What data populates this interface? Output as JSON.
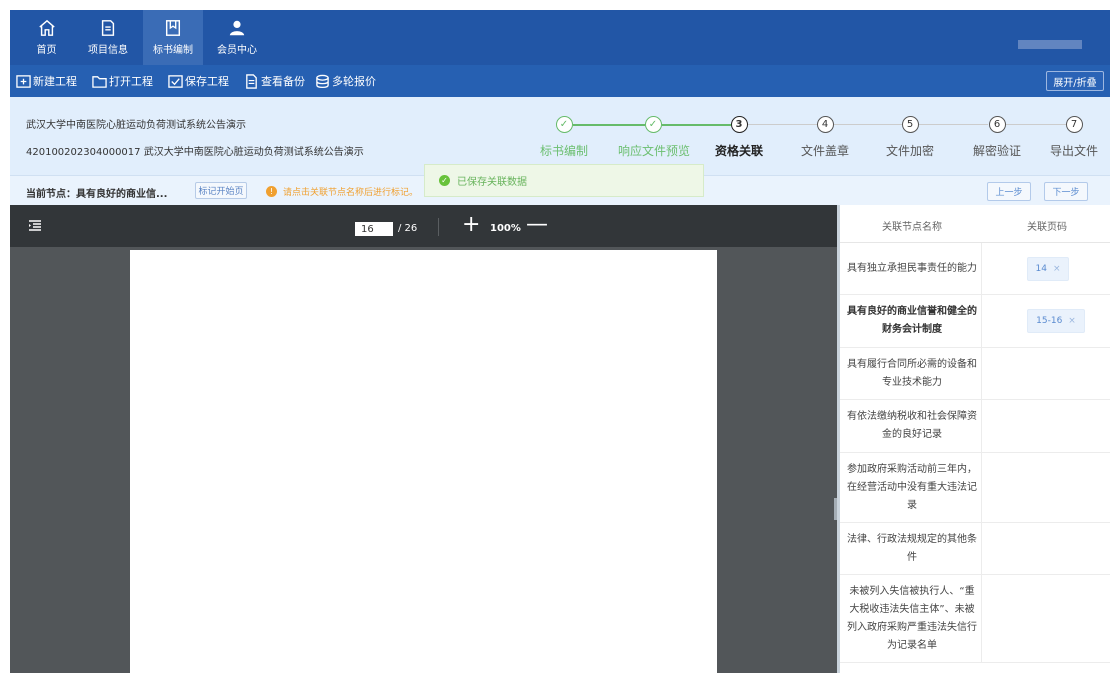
{
  "nav": {
    "items": [
      {
        "label": "首页",
        "icon": "home-icon"
      },
      {
        "label": "项目信息",
        "icon": "document-icon"
      },
      {
        "label": "标书编制",
        "icon": "bookmark-icon"
      },
      {
        "label": "会员中心",
        "icon": "user-icon"
      }
    ],
    "active": "标书编制"
  },
  "toolbar": {
    "new_project": "新建工程",
    "open_project": "打开工程",
    "save_project": "保存工程",
    "view_backup": "查看备份",
    "multi_round_quote": "多轮报价",
    "expand_collapse": "展开/折叠"
  },
  "project": {
    "name": "武汉大学中南医院心脏运动负荷测试系统公告演示",
    "code_and_name": "420100202304000017 武汉大学中南医院心脏运动负荷测试系统公告演示"
  },
  "steps": [
    {
      "num": "✓",
      "label": "标书编制",
      "state": "done"
    },
    {
      "num": "✓",
      "label": "响应文件预览",
      "state": "done"
    },
    {
      "num": "3",
      "label": "资格关联",
      "state": "active"
    },
    {
      "num": "4",
      "label": "文件盖章",
      "state": "todo"
    },
    {
      "num": "5",
      "label": "文件加密",
      "state": "todo"
    },
    {
      "num": "6",
      "label": "解密验证",
      "state": "todo"
    },
    {
      "num": "7",
      "label": "导出文件",
      "state": "todo"
    }
  ],
  "nodebar": {
    "current_node": "当前节点：具有良好的商业信...",
    "mark_start": "标记开始页",
    "warning_icon": "!",
    "warning": "请点击关联节点名称后进行标记。",
    "prev": "上一步",
    "next": "下一步"
  },
  "toast": {
    "icon": "check-circle-icon",
    "check": "✓",
    "text": "已保存关联数据"
  },
  "viewer": {
    "current_page": "16",
    "total_pages": "/ 26",
    "zoom": "100%",
    "zoom_in": "+",
    "zoom_out": "—"
  },
  "table": {
    "headers": [
      "关联节点名称",
      "关联页码"
    ],
    "rows": [
      {
        "name": "具有独立承担民事责任的能力",
        "tag": "14",
        "remove": "×"
      },
      {
        "name": "具有良好的商业信誉和健全的财务会计制度",
        "tag": "15-16",
        "remove": "×"
      },
      {
        "name": "具有履行合同所必需的设备和专业技术能力",
        "tag": ""
      },
      {
        "name": "有依法缴纳税收和社会保障资金的良好记录",
        "tag": ""
      },
      {
        "name": "参加政府采购活动前三年内，在经营活动中没有重大违法记录",
        "tag": ""
      },
      {
        "name": "法律、行政法规规定的其他条件",
        "tag": ""
      },
      {
        "name": "未被列入失信被执行人、“重大税收违法失信主体”、未被列入政府采购严重违法失信行为记录名单",
        "tag": ""
      }
    ]
  },
  "colors": {
    "nav_bg": "#2256a6",
    "toolbar_bg": "#2660b2",
    "header_bg": "#e1eefc",
    "step_done": "#66bb6a",
    "warning": "#f0a030",
    "pdf_bar": "#323639",
    "pdf_bg": "#525659"
  }
}
